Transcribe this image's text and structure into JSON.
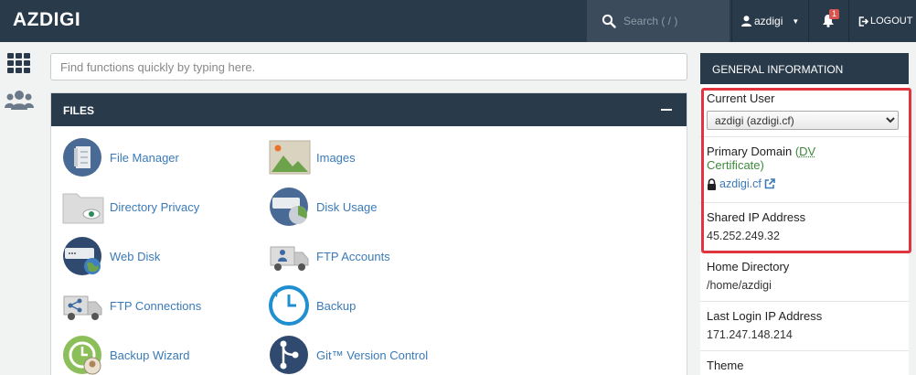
{
  "header": {
    "brand": "AZDIGI",
    "search_placeholder": "Search ( / )",
    "username": "azdigi",
    "notification_count": "1",
    "logout_label": "LOGOUT"
  },
  "quick_search": {
    "placeholder": "Find functions quickly by typing here."
  },
  "files_panel": {
    "title": "FILES",
    "items": [
      {
        "label": "File Manager",
        "icon": "file-manager-icon"
      },
      {
        "label": "Images",
        "icon": "images-icon"
      },
      {
        "label": "Directory Privacy",
        "icon": "directory-privacy-icon"
      },
      {
        "label": "Disk Usage",
        "icon": "disk-usage-icon"
      },
      {
        "label": "Web Disk",
        "icon": "web-disk-icon"
      },
      {
        "label": "FTP Accounts",
        "icon": "ftp-accounts-icon"
      },
      {
        "label": "FTP Connections",
        "icon": "ftp-connections-icon"
      },
      {
        "label": "Backup",
        "icon": "backup-icon"
      },
      {
        "label": "Backup Wizard",
        "icon": "backup-wizard-icon"
      },
      {
        "label": "Git™ Version Control",
        "icon": "git-icon"
      }
    ]
  },
  "general_info": {
    "title": "GENERAL INFORMATION",
    "current_user_label": "Current User",
    "current_user_value": "azdigi (azdigi.cf)",
    "primary_domain_label": "Primary Domain",
    "primary_domain_open": "(",
    "primary_domain_dv": "DV",
    "primary_domain_cert": "Certificate)",
    "primary_domain_value": "azdigi.cf",
    "shared_ip_label": "Shared IP Address",
    "shared_ip_value": "45.252.249.32",
    "home_dir_label": "Home Directory",
    "home_dir_value": "/home/azdigi",
    "last_login_label": "Last Login IP Address",
    "last_login_value": "171.247.148.214",
    "theme_label": "Theme"
  },
  "colors": {
    "navbar": "#293a4a",
    "link": "#3a7ab8",
    "highlight": "#e03440",
    "cert_green": "#3d8a3b"
  }
}
